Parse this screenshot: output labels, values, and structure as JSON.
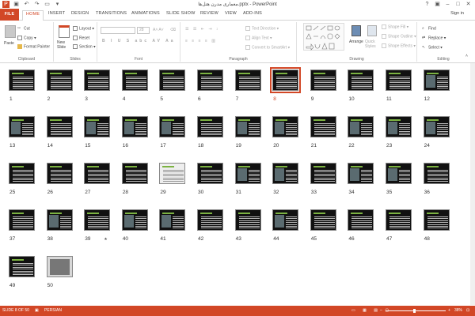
{
  "window": {
    "title": "معماری مدرن هتل‌ها.pptx - PowerPoint"
  },
  "tabs": [
    "FILE",
    "HOME",
    "INSERT",
    "DESIGN",
    "TRANSITIONS",
    "ANIMATIONS",
    "SLIDE SHOW",
    "REVIEW",
    "VIEW",
    "ADD-INS"
  ],
  "active_tab": "HOME",
  "signin": "Sign in",
  "ribbon": {
    "clipboard": {
      "paste": "Paste",
      "cut": "Cut",
      "copy": "Copy",
      "format_painter": "Format Painter",
      "label": "Clipboard"
    },
    "slides": {
      "new_slide": "New Slide",
      "layout": "Layout",
      "reset": "Reset",
      "section": "Section",
      "label": "Slides"
    },
    "font": {
      "size": "28",
      "label": "Font"
    },
    "paragraph": {
      "text_direction": "Text Direction",
      "align_text": "Align Text",
      "convert_smartart": "Convert to SmartArt",
      "label": "Paragraph"
    },
    "drawing": {
      "arrange": "Arrange",
      "quick_styles": "Quick Styles",
      "shape_fill": "Shape Fill",
      "shape_outline": "Shape Outline",
      "shape_effects": "Shape Effects",
      "label": "Drawing"
    },
    "editing": {
      "find": "Find",
      "replace": "Replace",
      "select": "Select",
      "label": "Editing"
    }
  },
  "slides": {
    "count": 50,
    "selected": 8,
    "star_slides": [
      39
    ]
  },
  "status": {
    "slide_of": "SLIDE 8 OF 50",
    "language": "PERSIAN",
    "zoom": "38%"
  },
  "colors": {
    "accent": "#d24726"
  }
}
